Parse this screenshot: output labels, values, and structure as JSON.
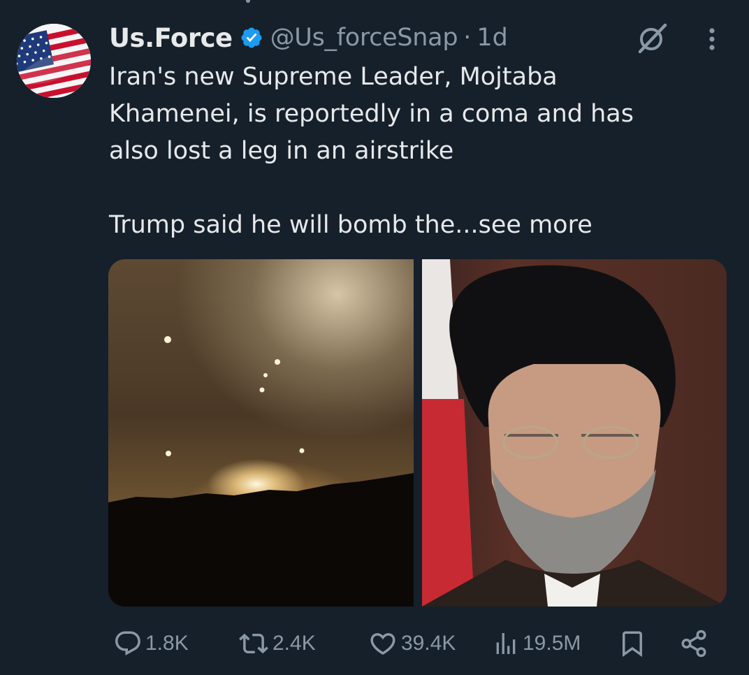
{
  "tweet": {
    "display_name": "Us.Force",
    "handle": "@Us_forceSnap",
    "separator": "·",
    "time": "1d",
    "text": "Iran's new Supreme Leader, Mojtaba\nKhamenei, is reportedly in a coma and has\nalso lost a leg in an airstrike\n\nTrump said he will bomb the",
    "see_more": "...see more"
  },
  "media": {
    "left_image": "night-airstrike-photo",
    "right_image": "cleric-portrait-photo"
  },
  "actions": {
    "replies": "1.8K",
    "reposts": "2.4K",
    "likes": "39.4K",
    "views": "19.5M"
  },
  "icons": {
    "avatar": "us-flag-avatar",
    "verified": "verified-badge-icon",
    "grok": "grok-icon",
    "more": "more-icon",
    "reply": "reply-icon",
    "repost": "repost-icon",
    "like": "like-icon",
    "views": "views-icon",
    "bookmark": "bookmark-icon",
    "share": "share-icon"
  },
  "colors": {
    "background": "#15202b",
    "text_primary": "#e7e9ea",
    "text_secondary": "#8b98a5",
    "verified_blue": "#1d9bf0"
  }
}
